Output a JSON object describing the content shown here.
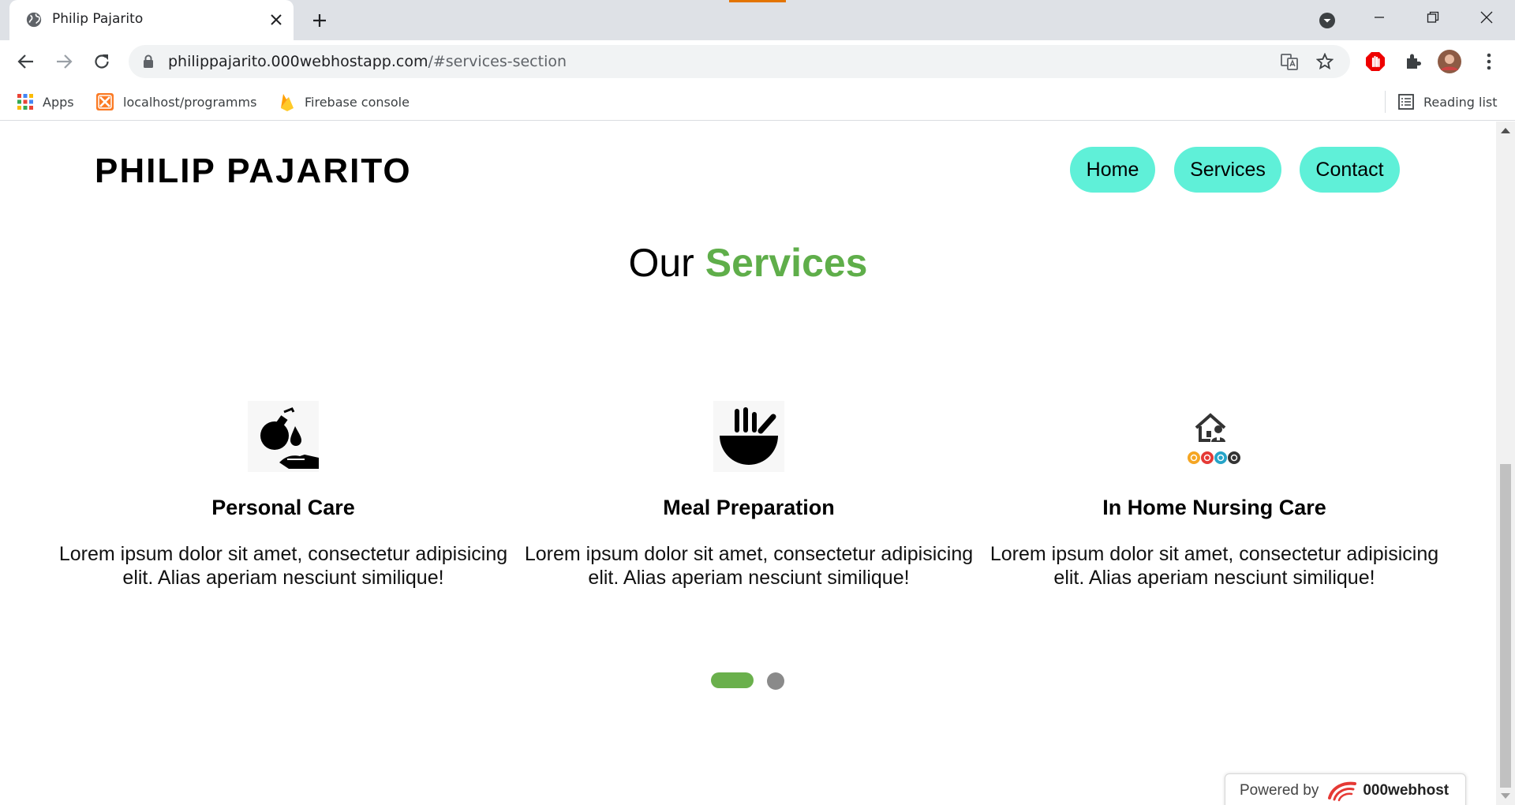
{
  "browser": {
    "tab_title": "Philip Pajarito",
    "url_host": "philippajarito.000webhostapp.com",
    "url_path": "/#services-section",
    "bookmarks": [
      {
        "label": "Apps",
        "icon": "apps-grid-icon"
      },
      {
        "label": "localhost/programms",
        "icon": "xampp-icon"
      },
      {
        "label": "Firebase console",
        "icon": "firebase-icon"
      }
    ],
    "reading_list": "Reading list"
  },
  "site": {
    "logo": "PHILIP PAJARITO",
    "nav": [
      "Home",
      "Services",
      "Contact"
    ]
  },
  "services": {
    "heading_plain": "Our",
    "heading_accent": "Services",
    "items": [
      {
        "title": "Personal Care",
        "text": "Lorem ipsum dolor sit amet, consectetur adipisicing elit. Alias aperiam nesciunt similique!",
        "icon": "lotion-hand-icon"
      },
      {
        "title": "Meal Preparation",
        "text": "Lorem ipsum dolor sit amet, consectetur adipisicing elit. Alias aperiam nesciunt similique!",
        "icon": "bowl-icon"
      },
      {
        "title": "In Home Nursing Care",
        "text": "Lorem ipsum dolor sit amet, consectetur adipisicing elit. Alias aperiam nesciunt similique!",
        "icon": "home-nursing-icon"
      }
    ],
    "carousel": {
      "active_index": 0,
      "dot_count": 2
    }
  },
  "footer": {
    "powered_prefix": "Powered by",
    "powered_brand": "000webhost"
  },
  "colors": {
    "nav_bg": "#5ff0d8",
    "accent": "#5fae4a",
    "dot_active": "#6ab04c",
    "dot_inactive": "#8a8a8a"
  }
}
